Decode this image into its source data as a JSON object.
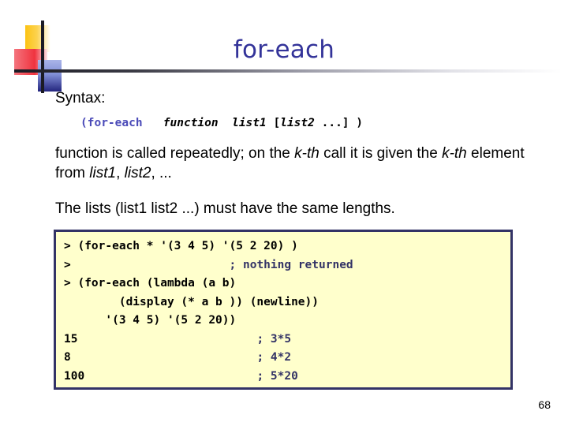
{
  "slide": {
    "title": "for-each",
    "page_number": "68",
    "accent_color": "#333399",
    "code_box_bg": "#ffffcc",
    "code_box_border": "#333366",
    "comment_color": "#333366"
  },
  "content": {
    "syntax_label": "Syntax:",
    "syntax_code": {
      "keyword": "(for-each",
      "gap1": "   ",
      "arg_function": "function",
      "gap2": "  ",
      "arg_list1": "list1",
      "bracket_open": " [",
      "arg_list2": "list2",
      "tail": " ...] )"
    },
    "paragraph_1": {
      "part_1": "function is called repeatedly; on the ",
      "em_1": "k-th",
      "part_2": " call it is given the ",
      "em_2": "k-th",
      "part_3": " element from ",
      "em_3": "list1",
      "part_4": ", ",
      "em_4": "list2",
      "part_5": ", ..."
    },
    "paragraph_2": "The lists (list1 list2 ...) must have the same lengths."
  },
  "code_block": {
    "lines": [
      {
        "code": "> (for-each * '(3 4 5) '(5 2 20) )",
        "comment": ""
      },
      {
        "code": ">",
        "pad": "                       ",
        "comment": "; nothing returned"
      },
      {
        "code": "> (for-each (lambda (a b)",
        "comment": ""
      },
      {
        "code": "        (display (* a b )) (newline))",
        "comment": ""
      },
      {
        "code": "      '(3 4 5) '(5 2 20))",
        "comment": ""
      },
      {
        "code": "15",
        "pad": "                          ",
        "comment": "; 3*5"
      },
      {
        "code": "8",
        "pad": "                           ",
        "comment": "; 4*2"
      },
      {
        "code": "100",
        "pad": "                         ",
        "comment": "; 5*20"
      }
    ]
  }
}
